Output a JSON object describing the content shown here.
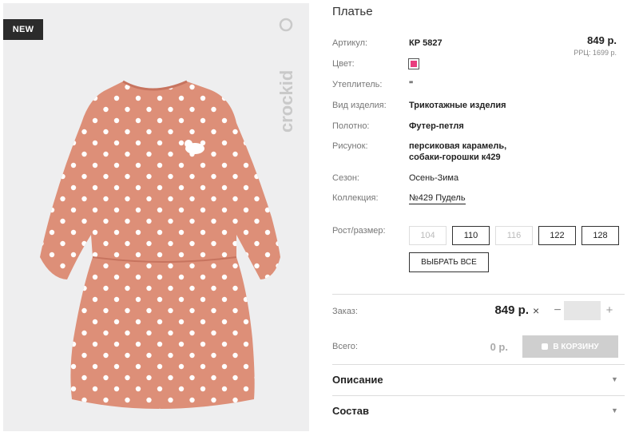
{
  "badge": "NEW",
  "brand": "crockid",
  "product": {
    "title": "Платье",
    "price": "849 р.",
    "rrp": "РРЦ: 1699 р.",
    "swatch_color": "#e83e7e"
  },
  "attributes": {
    "article_label": "Артикул:",
    "article_value": "КР 5827",
    "color_label": "Цвет:",
    "insulation_label": "Утеплитель:",
    "insulation_value": "\"",
    "type_label": "Вид изделия:",
    "type_value": "Трикотажные изделия",
    "fabric_label": "Полотно:",
    "fabric_value": "Футер-петля",
    "pattern_label": "Рисунок:",
    "pattern_line1": "персиковая карамель,",
    "pattern_line2": "собаки-горошки к429",
    "season_label": "Сезон:",
    "season_value": "Осень-Зима",
    "collection_label": "Коллекция:",
    "collection_value": "№429 Пудель"
  },
  "sizes": {
    "label": "Рост/размер:",
    "options": [
      {
        "label": "104",
        "available": false
      },
      {
        "label": "110",
        "available": true
      },
      {
        "label": "116",
        "available": false
      },
      {
        "label": "122",
        "available": true
      },
      {
        "label": "128",
        "available": true
      }
    ],
    "select_all": "ВЫБРАТЬ ВСЕ"
  },
  "order": {
    "label": "Заказ:",
    "price": "849 р.",
    "times": "×",
    "minus": "−",
    "plus": "+",
    "quantity": ""
  },
  "total": {
    "label": "Всего:",
    "value": "0 р.",
    "cart_button": "В КОРЗИНУ"
  },
  "accordions": {
    "description": "Описание",
    "composition": "Состав"
  },
  "colors": {
    "dress": "#dd8f78",
    "dot": "#ffffff",
    "photo_bg": "#eeeeef"
  }
}
